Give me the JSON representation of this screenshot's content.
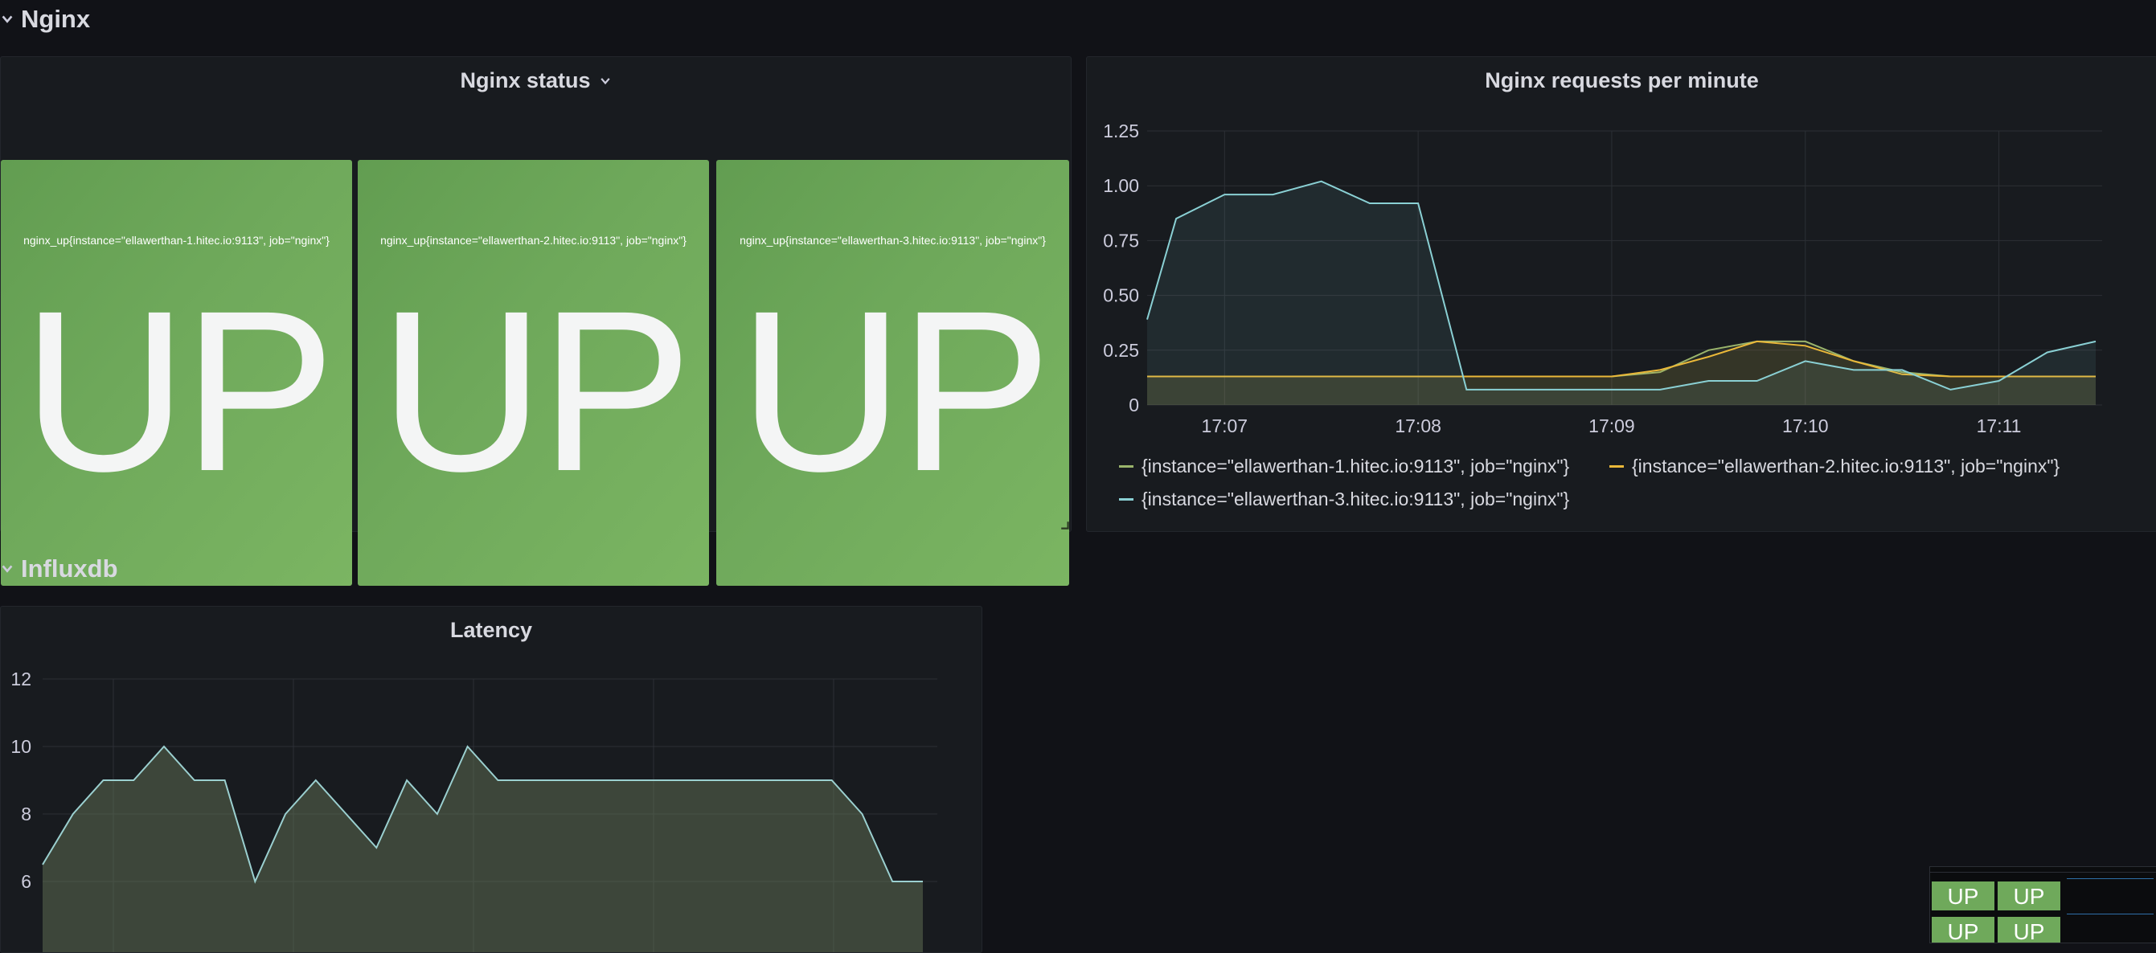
{
  "rows": {
    "nginx": {
      "title": "Nginx"
    },
    "influxdb": {
      "title": "Influxdb"
    }
  },
  "nginx_status": {
    "title": "Nginx status",
    "stats": [
      {
        "metric": "nginx_up{instance=\"ellawerthan-1.hitec.io:9113\", job=\"nginx\"}",
        "value": "UP"
      },
      {
        "metric": "nginx_up{instance=\"ellawerthan-2.hitec.io:9113\", job=\"nginx\"}",
        "value": "UP"
      },
      {
        "metric": "nginx_up{instance=\"ellawerthan-3.hitec.io:9113\", job=\"nginx\"}",
        "value": "UP"
      }
    ],
    "color": "#73b05c"
  },
  "requests_panel": {
    "title": "Nginx requests per minute",
    "legend": [
      {
        "label": "{instance=\"ellawerthan-1.hitec.io:9113\", job=\"nginx\"}",
        "color": "#9ab46b"
      },
      {
        "label": "{instance=\"ellawerthan-2.hitec.io:9113\", job=\"nginx\"}",
        "color": "#eab839"
      },
      {
        "label": "{instance=\"ellawerthan-3.hitec.io:9113\", job=\"nginx\"}",
        "color": "#8ad0d4"
      }
    ]
  },
  "latency_panel": {
    "title": "Latency"
  },
  "minimap": {
    "tiles": [
      "UP",
      "UP",
      "UP",
      "UP"
    ]
  },
  "chart_data": [
    {
      "type": "line",
      "title": "Nginx requests per minute",
      "xlabel": "",
      "ylabel": "",
      "x_ticks": [
        "17:07",
        "17:08",
        "17:09",
        "17:10",
        "17:11"
      ],
      "y_ticks": [
        "0",
        "0.25",
        "0.50",
        "0.75",
        "1.00",
        "1.25"
      ],
      "ylim": [
        0,
        1.25
      ],
      "grid": true,
      "legend_position": "bottom",
      "x": [
        "17:06:36",
        "17:06:45",
        "17:07:00",
        "17:07:15",
        "17:07:30",
        "17:07:45",
        "17:08:00",
        "17:08:15",
        "17:08:30",
        "17:08:45",
        "17:09:00",
        "17:09:15",
        "17:09:30",
        "17:09:45",
        "17:10:00",
        "17:10:15",
        "17:10:30",
        "17:10:45",
        "17:11:00",
        "17:11:15",
        "17:11:30"
      ],
      "series": [
        {
          "name": "{instance=\"ellawerthan-1.hitec.io:9113\", job=\"nginx\"}",
          "color": "#9ab46b",
          "values": [
            0.13,
            0.13,
            0.13,
            0.13,
            0.13,
            0.13,
            0.13,
            0.13,
            0.13,
            0.13,
            0.13,
            0.15,
            0.25,
            0.29,
            0.29,
            0.2,
            0.15,
            0.13,
            0.13,
            0.13,
            0.13
          ]
        },
        {
          "name": "{instance=\"ellawerthan-2.hitec.io:9113\", job=\"nginx\"}",
          "color": "#eab839",
          "values": [
            0.13,
            0.13,
            0.13,
            0.13,
            0.13,
            0.13,
            0.13,
            0.13,
            0.13,
            0.13,
            0.13,
            0.16,
            0.22,
            0.29,
            0.27,
            0.2,
            0.14,
            0.13,
            0.13,
            0.13,
            0.13
          ]
        },
        {
          "name": "{instance=\"ellawerthan-3.hitec.io:9113\", job=\"nginx\"}",
          "color": "#8ad0d4",
          "values": [
            0.39,
            0.85,
            0.96,
            0.96,
            1.02,
            0.92,
            0.92,
            0.07,
            0.07,
            0.07,
            0.07,
            0.07,
            0.11,
            0.11,
            0.2,
            0.16,
            0.16,
            0.07,
            0.11,
            0.24,
            0.29
          ]
        }
      ]
    },
    {
      "type": "area",
      "title": "Latency",
      "xlabel": "",
      "ylabel": "",
      "y_ticks": [
        "6",
        "8",
        "10",
        "12"
      ],
      "ylim": [
        4,
        12
      ],
      "grid": true,
      "values": [
        6.5,
        8,
        9,
        9,
        10,
        9,
        9,
        6,
        8,
        9,
        8,
        7,
        9,
        8,
        10,
        9,
        9,
        9,
        9,
        9,
        9,
        9,
        9,
        9,
        9,
        9,
        9,
        8,
        6,
        6
      ]
    }
  ]
}
